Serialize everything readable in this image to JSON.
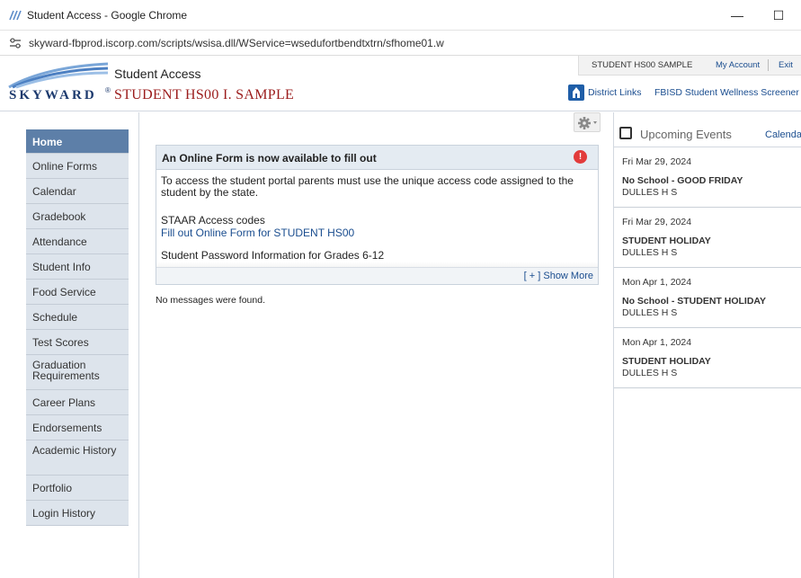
{
  "window": {
    "title": "Student Access - Google Chrome",
    "minimize_glyph": "—",
    "maximize_glyph": "☐"
  },
  "browser": {
    "url": "skyward-fbprod.iscorp.com/scripts/wsisa.dll/WService=wsedufortbendtxtrn/sfhome01.w"
  },
  "header": {
    "logo_text": "SKYWARD",
    "logo_reg": "®",
    "app_name": "Student Access",
    "student_name": "STUDENT HS00 I. SAMPLE",
    "user_name": "STUDENT HS00 SAMPLE",
    "my_account": "My Account",
    "exit": "Exit",
    "district_links": "District Links",
    "wellness_link": "FBISD Student Wellness Screener"
  },
  "nav": {
    "items": [
      {
        "label": "Home"
      },
      {
        "label": "Online Forms"
      },
      {
        "label": "Calendar"
      },
      {
        "label": "Gradebook"
      },
      {
        "label": "Attendance"
      },
      {
        "label": "Student Info"
      },
      {
        "label": "Food Service"
      },
      {
        "label": "Schedule"
      },
      {
        "label": "Test Scores"
      },
      {
        "label": "Graduation Requirements"
      },
      {
        "label": "Career Plans"
      },
      {
        "label": "Endorsements"
      },
      {
        "label": "Academic History"
      },
      {
        "label": "Portfolio"
      },
      {
        "label": "Login History"
      }
    ]
  },
  "main": {
    "form_box": {
      "title": "An Online Form is now available to fill out",
      "alert_glyph": "!",
      "body": "To access the student portal parents must use the unique access code assigned to the student by the state.",
      "staar": "STAAR Access codes",
      "fill_link": "Fill out Online Form for STUDENT HS00",
      "pw_info": "Student Password Information for Grades 6-12",
      "show_more": "[ + ] Show More"
    },
    "no_messages": "No messages were found."
  },
  "events": {
    "title": "Upcoming Events",
    "calendar_link": "Calendar",
    "items": [
      {
        "date": "Fri Mar 29, 2024",
        "name": "No School - GOOD FRIDAY",
        "school": "DULLES H S"
      },
      {
        "date": "Fri Mar 29, 2024",
        "name": "STUDENT HOLIDAY",
        "school": "DULLES H S"
      },
      {
        "date": "Mon Apr 1, 2024",
        "name": "No School - STUDENT HOLIDAY",
        "school": "DULLES H S"
      },
      {
        "date": "Mon Apr 1, 2024",
        "name": "STUDENT HOLIDAY",
        "school": "DULLES H S"
      }
    ]
  },
  "colors": {
    "brand_navy": "#1d3a6e",
    "student_name_red": "#9b1c1c",
    "nav_active": "#5d7fa8",
    "nav_bg": "#dde4ec",
    "link_blue": "#1a4d8f",
    "alert_red": "#e23b3b"
  }
}
